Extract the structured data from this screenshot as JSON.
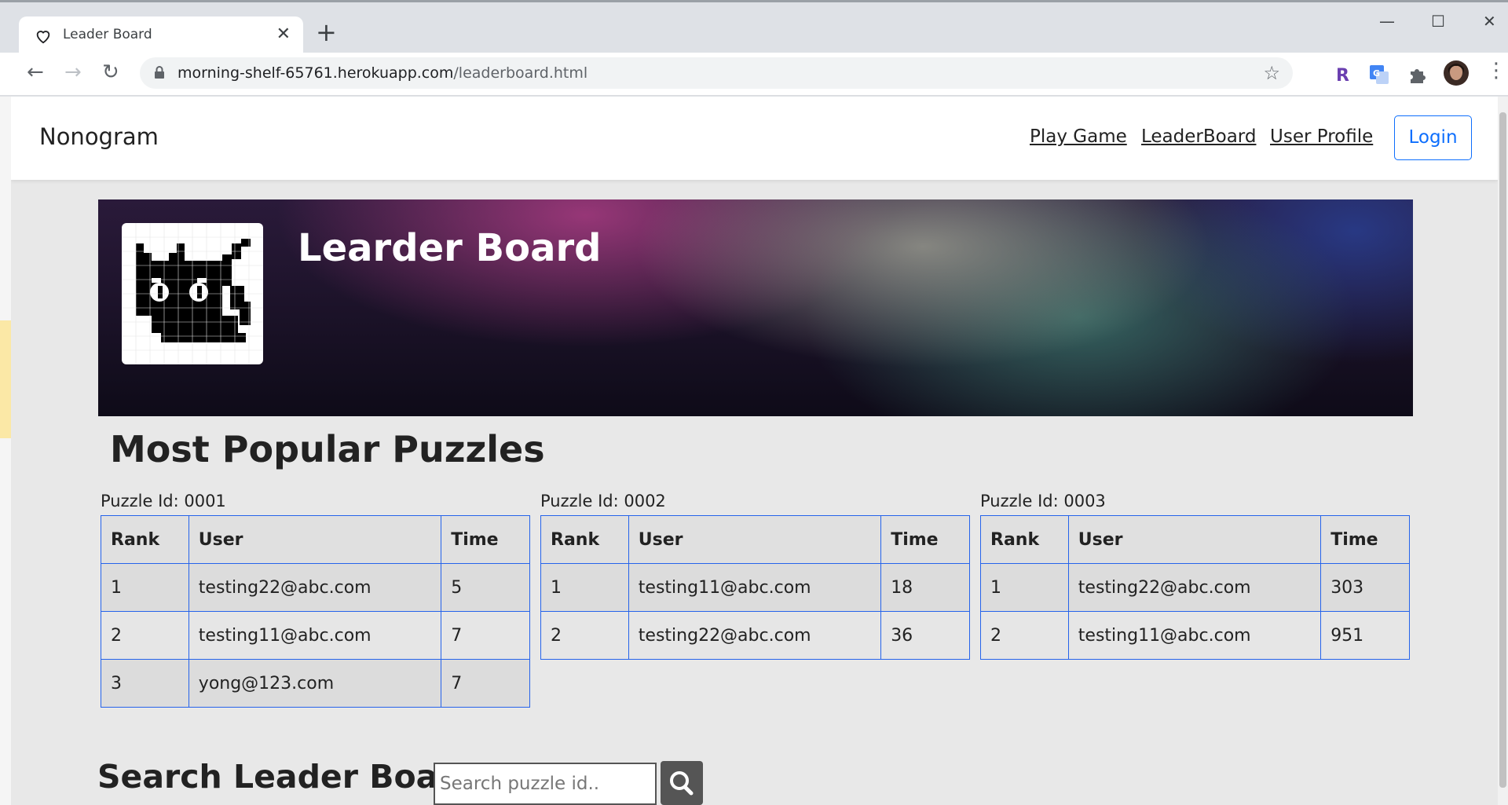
{
  "browser": {
    "tab_title": "Leader Board",
    "url_host": "morning-shelf-65761.herokuapp.com",
    "url_path": "/leaderboard.html"
  },
  "navbar": {
    "brand": "Nonogram",
    "links": [
      "Play Game",
      "LeaderBoard",
      "User Profile"
    ],
    "login_label": "Login",
    "accent_color": "#0d6efd"
  },
  "banner": {
    "title": "Learder Board"
  },
  "popular": {
    "title": "Most Popular Puzzles",
    "columns": [
      "Rank",
      "User",
      "Time"
    ],
    "puzzles": [
      {
        "label": "Puzzle Id: 0001",
        "rows": [
          [
            "1",
            "testing22@abc.com",
            "5"
          ],
          [
            "2",
            "testing11@abc.com",
            "7"
          ],
          [
            "3",
            "yong@123.com",
            "7"
          ]
        ]
      },
      {
        "label": "Puzzle Id: 0002",
        "rows": [
          [
            "1",
            "testing11@abc.com",
            "18"
          ],
          [
            "2",
            "testing22@abc.com",
            "36"
          ]
        ]
      },
      {
        "label": "Puzzle Id: 0003",
        "rows": [
          [
            "1",
            "testing22@abc.com",
            "303"
          ],
          [
            "2",
            "testing11@abc.com",
            "951"
          ]
        ]
      }
    ]
  },
  "search": {
    "title": "Search Leader Board",
    "placeholder": "Search puzzle id..",
    "button_icon": "search-icon"
  }
}
